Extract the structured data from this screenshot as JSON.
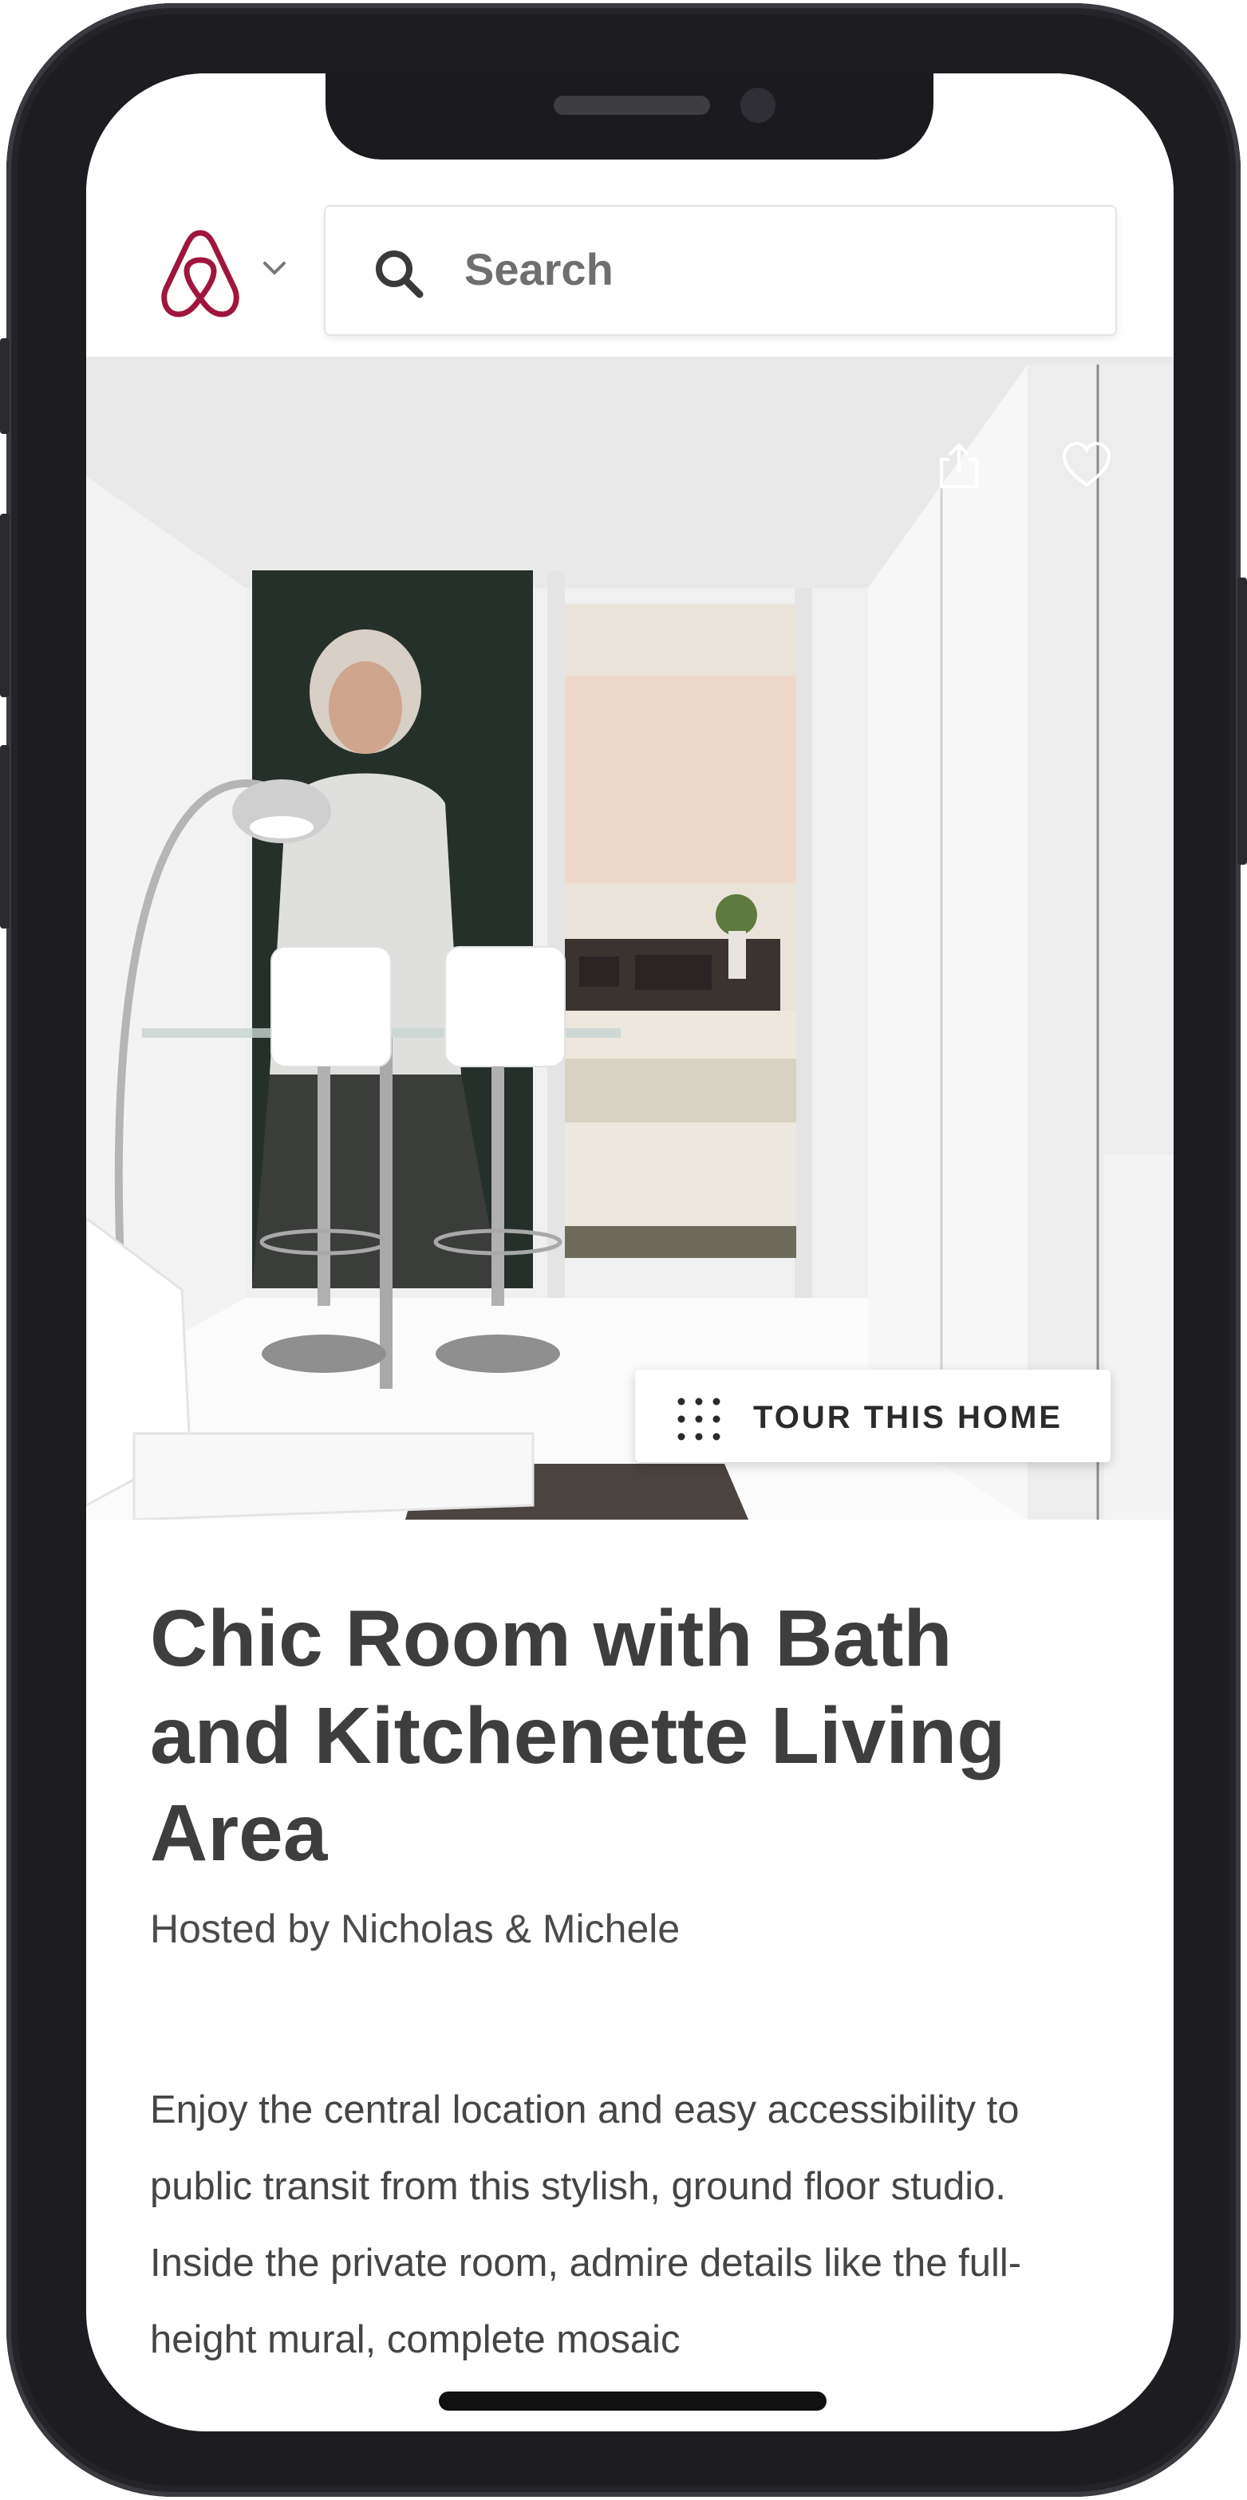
{
  "header": {
    "search": {
      "placeholder": "Search"
    }
  },
  "hero": {
    "tour_button": {
      "label": "TOUR THIS HOME"
    }
  },
  "listing": {
    "title": "Chic Room with Bath and Kitchenette Living Area",
    "host": "Hosted by Nicholas & Michele",
    "description": "Enjoy the central location and easy accessibility to public transit from this stylish, ground floor studio. Inside the private room, admire details like the full-height mural, complete mosaic"
  },
  "colors": {
    "brand": "#a0153e",
    "title_text": "#3e3e3e",
    "body_text": "#454545",
    "device_frame": "#1d1d21"
  },
  "icons": [
    "airbnb-logo",
    "chevron-down-icon",
    "search-icon",
    "share-icon",
    "heart-icon",
    "grid-dots-icon"
  ]
}
